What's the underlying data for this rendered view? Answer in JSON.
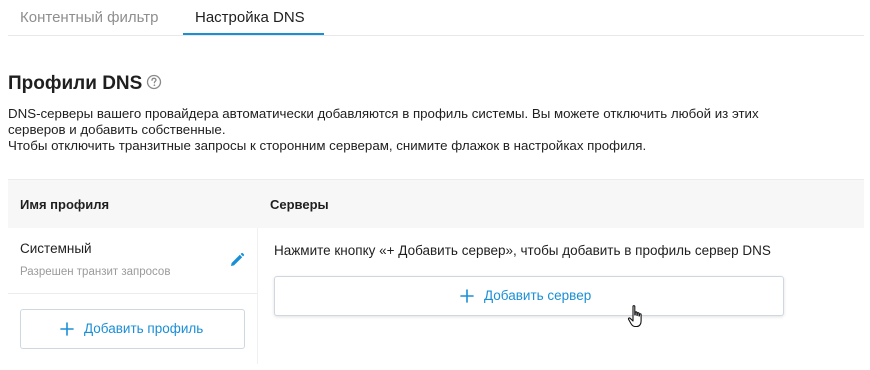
{
  "tabs": [
    {
      "label": "Контентный фильтр",
      "active": false
    },
    {
      "label": "Настройка DNS",
      "active": true
    }
  ],
  "section": {
    "title": "Профили DNS",
    "help_icon": "question-circle-icon",
    "description_lines": [
      "DNS-серверы вашего провайдера автоматически добавляются в профиль системы. Вы можете отключить любой из этих",
      "серверов и добавить собственные.",
      "Чтобы отключить транзитные запросы к сторонним серверам, снимите флажок в настройках профиля."
    ]
  },
  "table": {
    "headers": {
      "profile": "Имя профиля",
      "servers": "Серверы"
    },
    "profile": {
      "name": "Системный",
      "subtitle": "Разрешен транзит запросов",
      "edit_icon": "pencil-icon"
    },
    "servers_hint": "Нажмите кнопку «+ Добавить сервер», чтобы добавить в профиль сервер DNS",
    "add_server_label": "Добавить сервер",
    "add_profile_label": "Добавить профиль"
  },
  "colors": {
    "accent": "#1a8fd6",
    "header_bg": "#f7f7f7",
    "muted_text": "#9a9a9a"
  }
}
